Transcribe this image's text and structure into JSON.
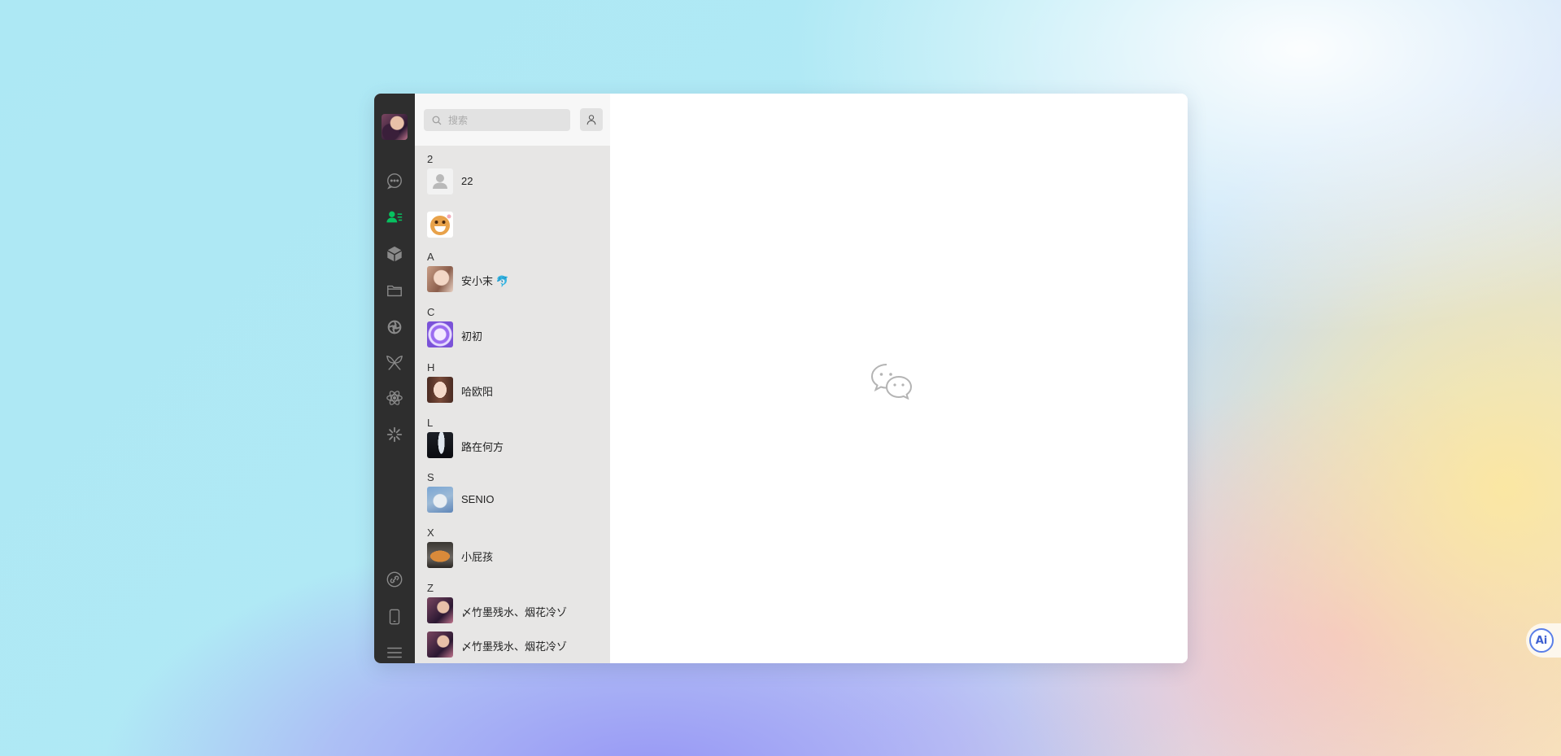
{
  "search": {
    "placeholder": "搜索"
  },
  "rail": {
    "items": [
      {
        "name": "chat-icon",
        "active": false
      },
      {
        "name": "contacts-icon",
        "active": true
      },
      {
        "name": "box-icon",
        "active": false
      },
      {
        "name": "folder-icon",
        "active": false
      },
      {
        "name": "moments-icon",
        "active": false
      },
      {
        "name": "butterfly-icon",
        "active": false
      },
      {
        "name": "atom-icon",
        "active": false
      },
      {
        "name": "spark-icon",
        "active": false
      },
      {
        "name": "link-icon",
        "active": false
      },
      {
        "name": "phone-icon",
        "active": false
      },
      {
        "name": "menu-icon",
        "active": false
      }
    ],
    "accent": "#07c160"
  },
  "contacts": {
    "groups": [
      {
        "letter": "2",
        "items": [
          {
            "name": "22",
            "avatar": "default"
          },
          {
            "name": "",
            "avatar": "emoji-grin"
          }
        ]
      },
      {
        "letter": "A",
        "items": [
          {
            "name": "安小末 🐬",
            "avatar": "girl-1"
          }
        ]
      },
      {
        "letter": "C",
        "items": [
          {
            "name": "初初",
            "avatar": "purple-circle"
          }
        ]
      },
      {
        "letter": "H",
        "items": [
          {
            "name": "哈欧阳",
            "avatar": "girl-2"
          }
        ]
      },
      {
        "letter": "L",
        "items": [
          {
            "name": "路在何方",
            "avatar": "dark-light"
          }
        ]
      },
      {
        "letter": "S",
        "items": [
          {
            "name": "SENIO",
            "avatar": "cat"
          }
        ]
      },
      {
        "letter": "X",
        "items": [
          {
            "name": "小屁孩",
            "avatar": "pan"
          }
        ]
      },
      {
        "letter": "Z",
        "items": [
          {
            "name": "〆竹墨残水、烟花冷ゾ",
            "avatar": "galaxy"
          },
          {
            "name": "〆竹墨残水、烟花冷ゾ",
            "avatar": "galaxy"
          }
        ]
      }
    ]
  },
  "ai_button": {
    "label": "Ai"
  }
}
